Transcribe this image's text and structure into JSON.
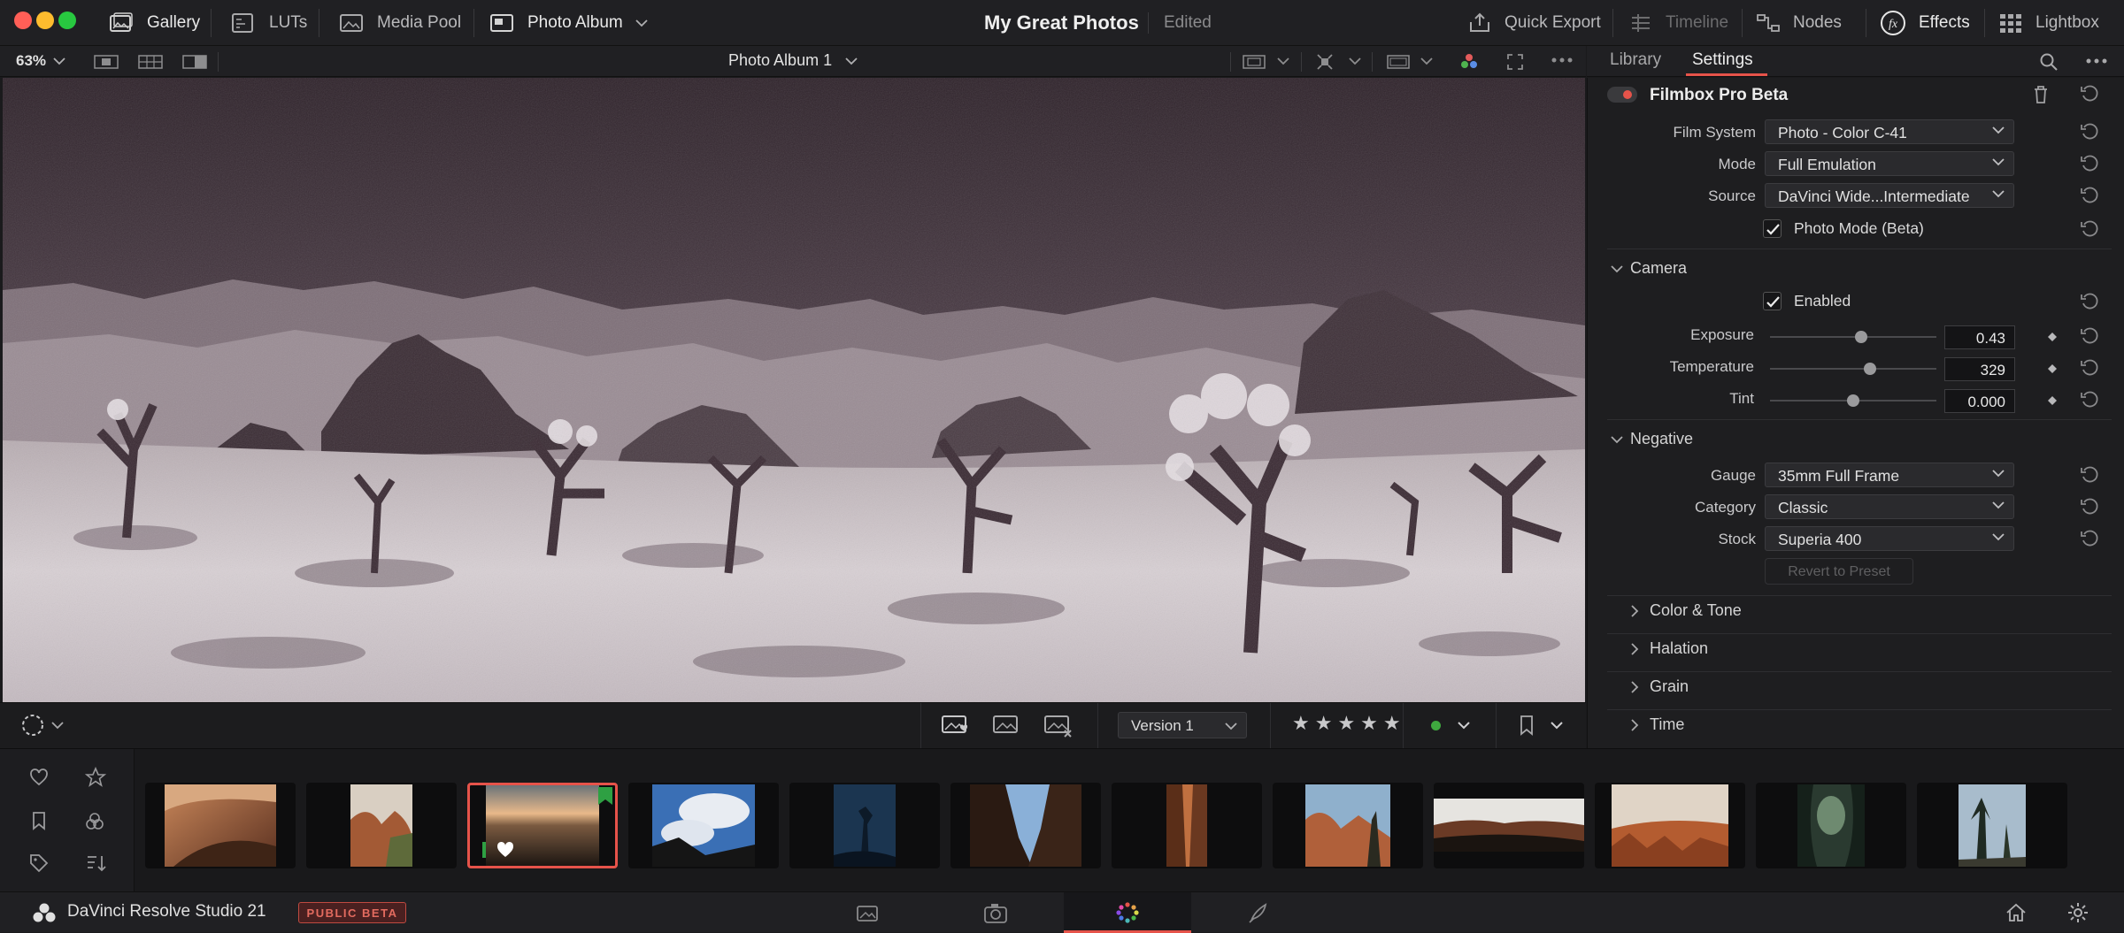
{
  "window": {
    "traffic_lights": [
      "#ff5f57",
      "#febc2e",
      "#28c840"
    ]
  },
  "topbar": {
    "gallery": "Gallery",
    "luts": "LUTs",
    "media_pool": "Media Pool",
    "photo_album": "Photo Album",
    "project_title": "My Great Photos",
    "project_status": "Edited",
    "quick_export": "Quick Export",
    "timeline": "Timeline",
    "nodes": "Nodes",
    "effects": "Effects",
    "lightbox": "Lightbox"
  },
  "viewer_toolbar": {
    "zoom": "63%",
    "album_name": "Photo Album 1"
  },
  "panel": {
    "tabs": [
      "Library",
      "Settings"
    ],
    "active_tab": "Settings",
    "effect_name": "Filmbox Pro Beta",
    "film_system": {
      "label": "Film System",
      "value": "Photo - Color C-41"
    },
    "mode": {
      "label": "Mode",
      "value": "Full Emulation"
    },
    "source": {
      "label": "Source",
      "value": "DaVinci Wide...Intermediate"
    },
    "photo_mode": {
      "label": "Photo Mode (Beta)",
      "checked": true
    },
    "camera": {
      "title": "Camera",
      "enabled": {
        "label": "Enabled",
        "checked": true
      },
      "exposure": {
        "label": "Exposure",
        "value": "0.43",
        "level": 0.55
      },
      "temperature": {
        "label": "Temperature",
        "value": "329",
        "level": 0.6
      },
      "tint": {
        "label": "Tint",
        "value": "0.000",
        "level": 0.5
      }
    },
    "negative": {
      "title": "Negative",
      "gauge": {
        "label": "Gauge",
        "value": "35mm Full Frame"
      },
      "category": {
        "label": "Category",
        "value": "Classic"
      },
      "stock": {
        "label": "Stock",
        "value": "Superia 400"
      },
      "revert": "Revert to Preset"
    },
    "collapsed_sections": [
      "Color & Tone",
      "Halation",
      "Grain",
      "Time"
    ]
  },
  "viewer_bottom": {
    "version": "Version 1",
    "rating": "★★★★★",
    "flag_color": "#3fa83f"
  },
  "filmstrip": {
    "thumb_count": 12,
    "selected_index": 2,
    "selected_flag_color": "#2ea043"
  },
  "bottombar": {
    "app_name": "DaVinci Resolve Studio 21",
    "badge": "PUBLIC BETA",
    "accent": "#e6534a"
  }
}
